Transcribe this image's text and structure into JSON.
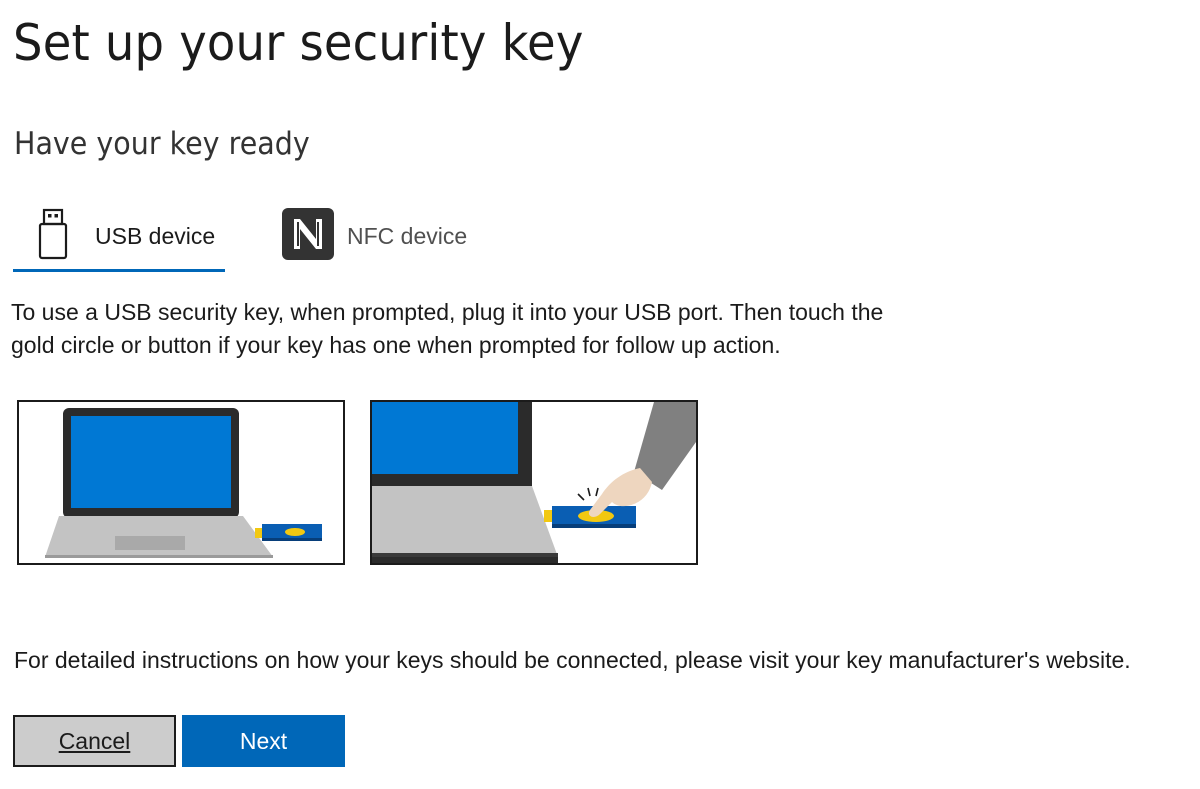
{
  "page": {
    "title": "Set up your security key",
    "subtitle": "Have your key ready"
  },
  "tabs": [
    {
      "label": "USB device",
      "icon": "usb-drive-icon",
      "selected": true
    },
    {
      "label": "NFC device",
      "icon": "nfc-icon",
      "selected": false
    }
  ],
  "content": {
    "description": "To use a USB security key, when prompted, plug it into your USB port. Then touch the gold circle or button if your key has one when prompted for follow up action.",
    "help_text": "For detailed instructions on how your keys should be connected, please visit your key manufacturer's website."
  },
  "illustrations": [
    {
      "name": "laptop-with-usb-key-illustration"
    },
    {
      "name": "finger-touching-key-illustration"
    }
  ],
  "buttons": {
    "cancel_label": "Cancel",
    "next_label": "Next"
  },
  "colors": {
    "accent": "#0067b8",
    "screen_blue": "#0078d4",
    "key_blue": "#0a5eb3",
    "gold": "#f2c811",
    "laptop_gray": "#c3c3c3"
  }
}
